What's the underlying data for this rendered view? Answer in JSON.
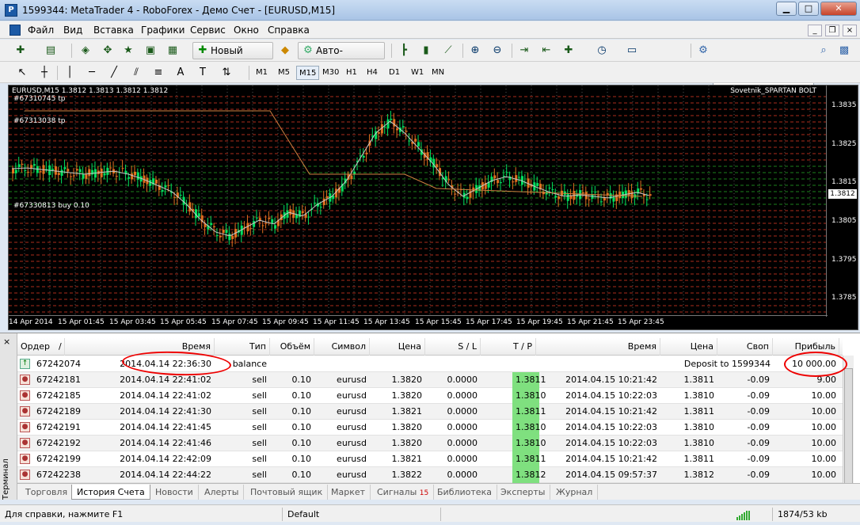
{
  "window": {
    "title": "1599344: MetaTrader 4 - RoboForex - Демо Счет - [EURUSD,M15]"
  },
  "menu": {
    "items": [
      "Файл",
      "Вид",
      "Вставка",
      "Графики",
      "Сервис",
      "Окно",
      "Справка"
    ]
  },
  "toolbar": {
    "new_order": "Новый Ордер",
    "auto_trading": "Авто-торговля"
  },
  "timeframes": [
    "M1",
    "M5",
    "M15",
    "M30",
    "H1",
    "H4",
    "D1",
    "W1",
    "MN"
  ],
  "timeframe_active": "M15",
  "chart": {
    "symbol_line": "EURUSD,M15  1.3812 1.3813 1.3812 1.3812",
    "ea_label": "Sovetnik_SPARTAN BOLT",
    "price_labels": [
      "1.3835",
      "1.3825",
      "1.3815",
      "1.3812",
      "1.3805",
      "1.3795",
      "1.3785"
    ],
    "current_price": "1.3812",
    "time_labels": [
      "14 Apr 2014",
      "15 Apr 01:45",
      "15 Apr 03:45",
      "15 Apr 05:45",
      "15 Apr 07:45",
      "15 Apr 09:45",
      "15 Apr 11:45",
      "15 Apr 13:45",
      "15 Apr 15:45",
      "15 Apr 17:45",
      "15 Apr 19:45",
      "15 Apr 21:45",
      "15 Apr 23:45"
    ],
    "order_labels": [
      "#67310745 tp",
      "#67313038 tp",
      "#67330813 buy 0.10"
    ]
  },
  "table": {
    "headers": [
      "Ордер",
      "/",
      "Время",
      "Тип",
      "Объём",
      "Символ",
      "Цена",
      "S / L",
      "T / P",
      "Время",
      "Цена",
      "Своп",
      "Прибыль"
    ],
    "balance_row": {
      "order": "67242074",
      "time": "2014.04.14 22:36:30",
      "type": "balance",
      "comment": "Deposit to 1599344",
      "profit": "10 000.00"
    },
    "rows": [
      {
        "order": "67242181",
        "time": "2014.04.14 22:41:02",
        "type": "sell",
        "volume": "0.10",
        "symbol": "eurusd",
        "price": "1.3820",
        "sl": "0.0000",
        "tp": "1.3811",
        "close_time": "2014.04.15 10:21:42",
        "close_price": "1.3811",
        "swap": "-0.09",
        "profit": "9.00"
      },
      {
        "order": "67242185",
        "time": "2014.04.14 22:41:02",
        "type": "sell",
        "volume": "0.10",
        "symbol": "eurusd",
        "price": "1.3820",
        "sl": "0.0000",
        "tp": "1.3810",
        "close_time": "2014.04.15 10:22:03",
        "close_price": "1.3810",
        "swap": "-0.09",
        "profit": "10.00"
      },
      {
        "order": "67242189",
        "time": "2014.04.14 22:41:30",
        "type": "sell",
        "volume": "0.10",
        "symbol": "eurusd",
        "price": "1.3821",
        "sl": "0.0000",
        "tp": "1.3811",
        "close_time": "2014.04.15 10:21:42",
        "close_price": "1.3811",
        "swap": "-0.09",
        "profit": "10.00"
      },
      {
        "order": "67242191",
        "time": "2014.04.14 22:41:45",
        "type": "sell",
        "volume": "0.10",
        "symbol": "eurusd",
        "price": "1.3820",
        "sl": "0.0000",
        "tp": "1.3810",
        "close_time": "2014.04.15 10:22:03",
        "close_price": "1.3810",
        "swap": "-0.09",
        "profit": "10.00"
      },
      {
        "order": "67242192",
        "time": "2014.04.14 22:41:46",
        "type": "sell",
        "volume": "0.10",
        "symbol": "eurusd",
        "price": "1.3820",
        "sl": "0.0000",
        "tp": "1.3810",
        "close_time": "2014.04.15 10:22:03",
        "close_price": "1.3810",
        "swap": "-0.09",
        "profit": "10.00"
      },
      {
        "order": "67242199",
        "time": "2014.04.14 22:42:09",
        "type": "sell",
        "volume": "0.10",
        "symbol": "eurusd",
        "price": "1.3821",
        "sl": "0.0000",
        "tp": "1.3811",
        "close_time": "2014.04.15 10:21:42",
        "close_price": "1.3811",
        "swap": "-0.09",
        "profit": "10.00"
      },
      {
        "order": "67242238",
        "time": "2014.04.14 22:44:22",
        "type": "sell",
        "volume": "0.10",
        "symbol": "eurusd",
        "price": "1.3822",
        "sl": "0.0000",
        "tp": "1.3812",
        "close_time": "2014.04.15 09:57:37",
        "close_price": "1.3812",
        "swap": "-0.09",
        "profit": "10.00"
      }
    ]
  },
  "terminal": {
    "side_label": "Терминал",
    "close": "×"
  },
  "tabs": [
    {
      "label": "Торговля"
    },
    {
      "label": "История Счета",
      "active": true
    },
    {
      "label": "Новости"
    },
    {
      "label": "Алерты"
    },
    {
      "label": "Почтовый ящик"
    },
    {
      "label": "Маркет"
    },
    {
      "label": "Сигналы",
      "badge": "15"
    },
    {
      "label": "Библиотека"
    },
    {
      "label": "Эксперты"
    },
    {
      "label": "Журнал"
    }
  ],
  "status": {
    "help": "Для справки, нажмите F1",
    "profile": "Default",
    "traffic": "1874/53 kb"
  },
  "colors": {
    "tp_cell": "#7fe07f",
    "bull_candle": "#00e060",
    "bear_candle": "#e07020",
    "grid_red": "#c03020",
    "grid_green": "#209020",
    "annotation": "#e00000"
  }
}
